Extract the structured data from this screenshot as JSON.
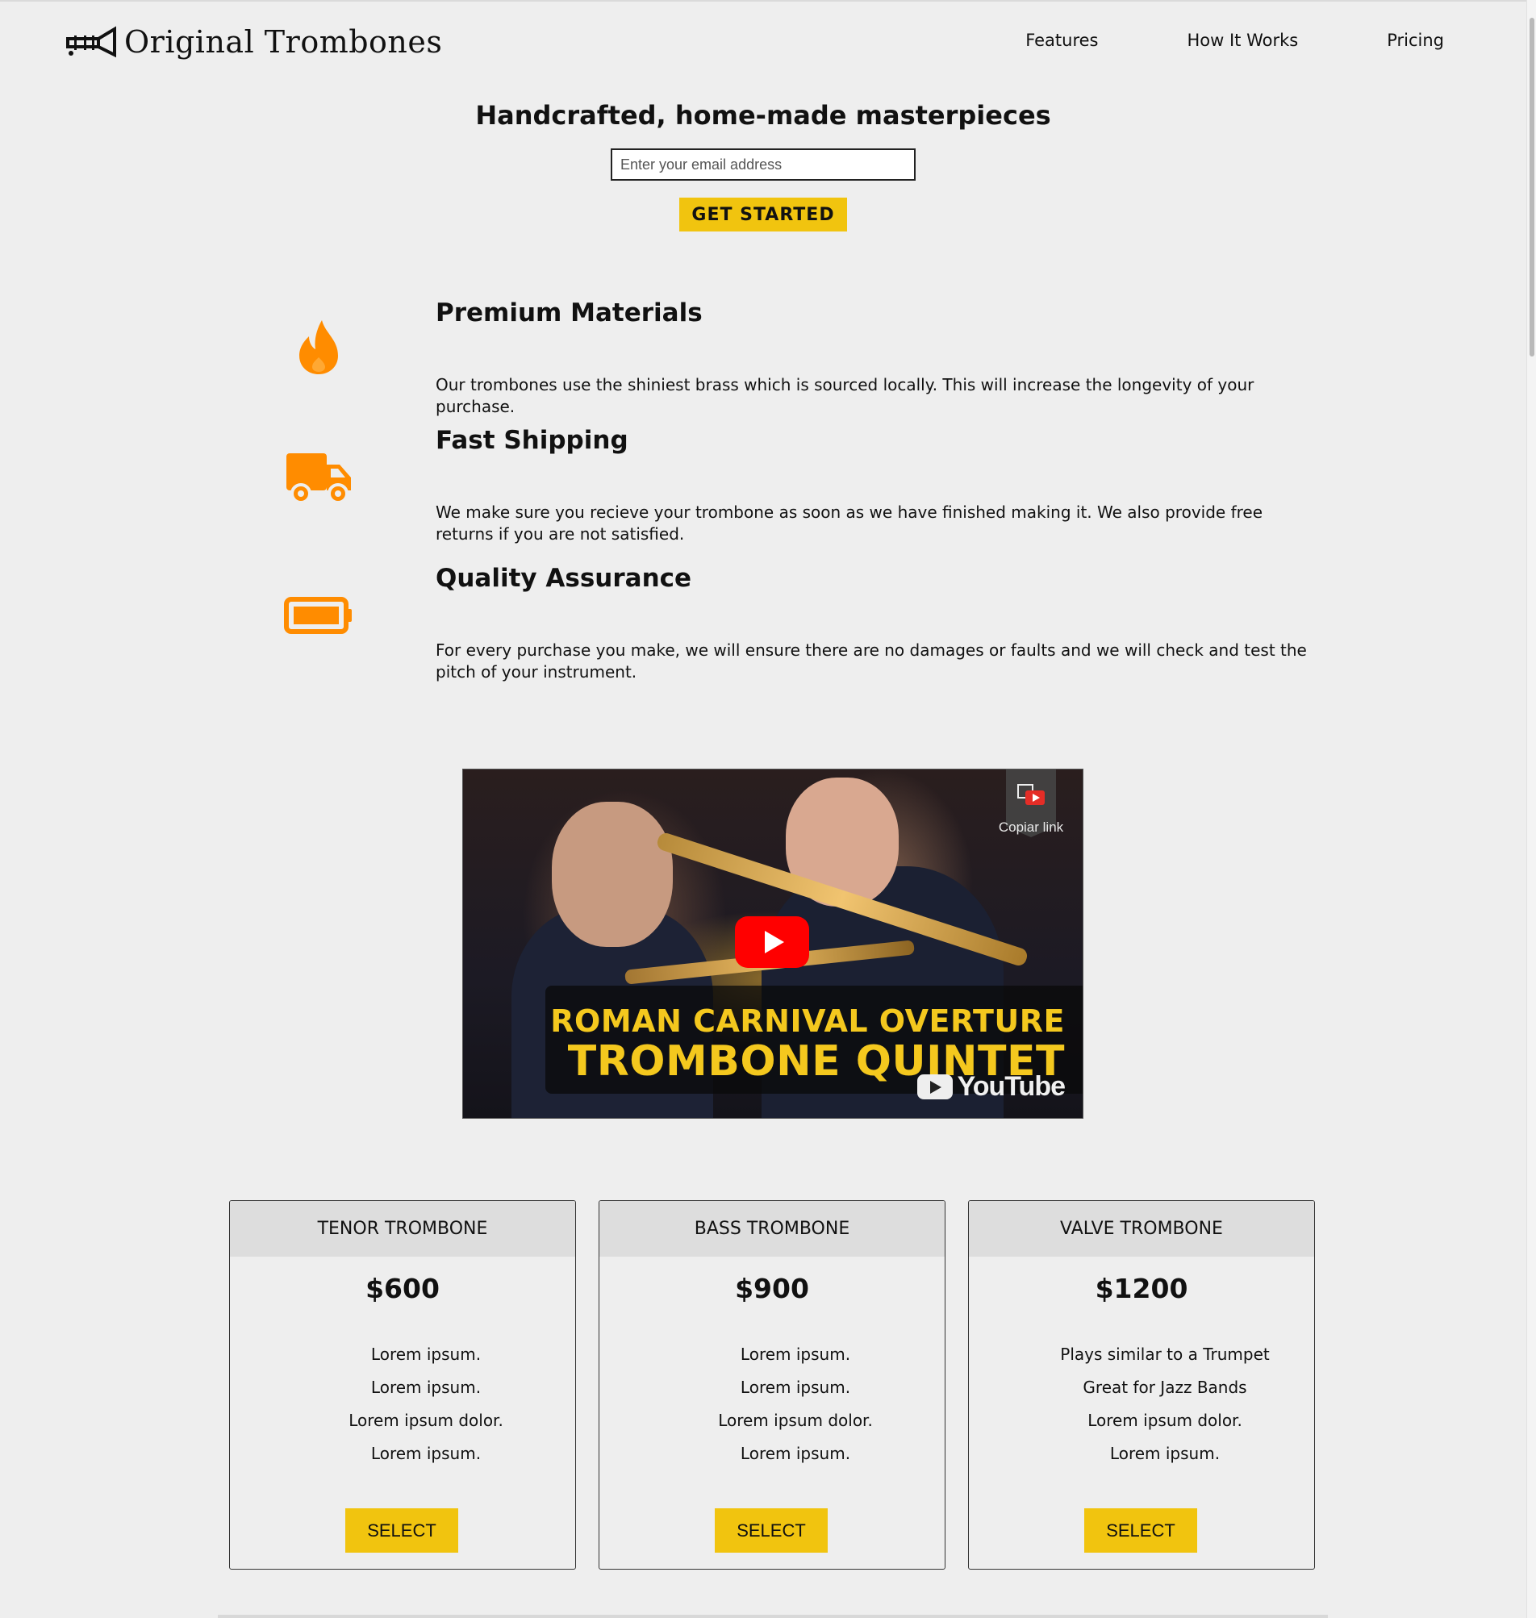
{
  "header": {
    "logo_icon": "trombone-icon",
    "brand": "Original Trombones",
    "nav": [
      {
        "label": "Features"
      },
      {
        "label": "How It Works"
      },
      {
        "label": "Pricing"
      }
    ]
  },
  "hero": {
    "title": "Handcrafted, home-made masterpieces",
    "email_placeholder": "Enter your email address",
    "email_value": "",
    "cta_label": "GET STARTED"
  },
  "features": [
    {
      "icon": "fire-icon",
      "title": "Premium Materials",
      "text": "Our trombones use the shiniest brass which is sourced locally. This will increase the longevity of your purchase."
    },
    {
      "icon": "truck-icon",
      "title": "Fast Shipping",
      "text": "We make sure you recieve your trombone as soon as we have finished making it. We also provide free returns if you are not satisfied."
    },
    {
      "icon": "battery-icon",
      "title": "Quality Assurance",
      "text": "For every purchase you make, we will ensure there are no damages or faults and we will check and test the pitch of your instrument."
    }
  ],
  "video": {
    "title_line1": "ROMAN CARNIVAL OVERTURE",
    "title_line2": "TROMBONE QUINTET",
    "copy_link_label": "Copiar link",
    "platform_label": "YouTube",
    "play_icon": "play-icon"
  },
  "pricing": [
    {
      "name": "TENOR TROMBONE",
      "price": "$600",
      "features": [
        "Lorem ipsum.",
        "Lorem ipsum.",
        "Lorem ipsum dolor.",
        "Lorem ipsum."
      ],
      "button": "SELECT"
    },
    {
      "name": "BASS TROMBONE",
      "price": "$900",
      "features": [
        "Lorem ipsum.",
        "Lorem ipsum.",
        "Lorem ipsum dolor.",
        "Lorem ipsum."
      ],
      "button": "SELECT"
    },
    {
      "name": "VALVE TROMBONE",
      "price": "$1200",
      "features": [
        "Plays similar to a Trumpet",
        "Great for Jazz Bands",
        "Lorem ipsum dolor.",
        "Lorem ipsum."
      ],
      "button": "SELECT"
    }
  ],
  "colors": {
    "accent": "#f1c40f",
    "icon_orange": "#ff8c00",
    "background": "#eeeeee",
    "card_header": "#dddddd",
    "youtube_red": "#ff0000",
    "video_title": "#f4c81e"
  }
}
